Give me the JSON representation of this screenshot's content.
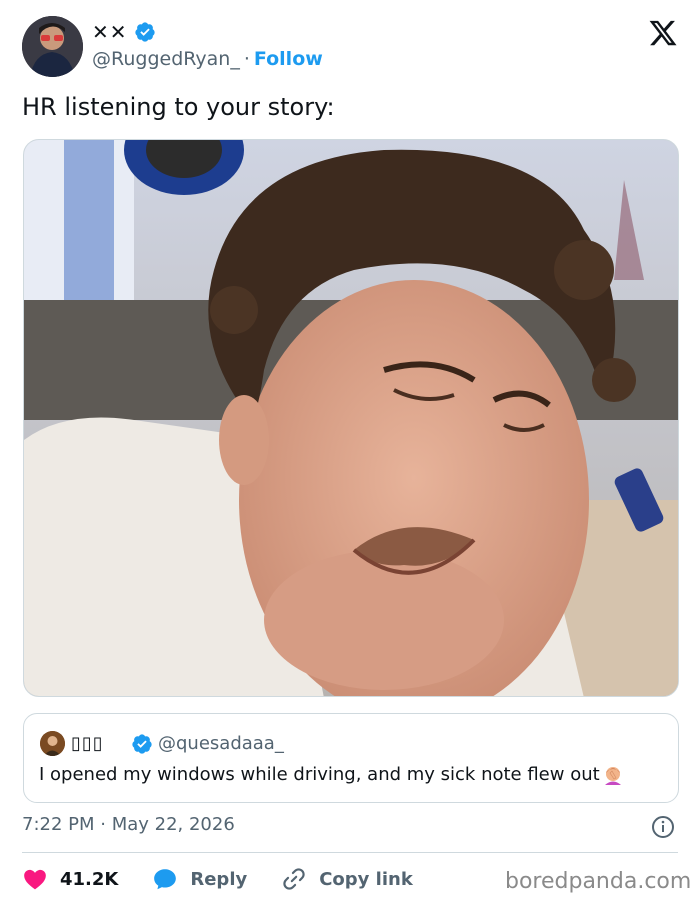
{
  "author": {
    "display_name": "✕✕",
    "handle": "@RuggedRyan_",
    "separator": "·",
    "follow_label": "Follow"
  },
  "tweet": {
    "text": "HR listening to your story:",
    "timestamp": "7:22 PM · May 22, 2026"
  },
  "quote": {
    "display_name": "▯▯▯",
    "handle": "@quesadaaa_",
    "text": "I opened my windows while driving, and my sick note flew out"
  },
  "engagement": {
    "likes": "41.2K",
    "reply_label": "Reply",
    "copy_link_label": "Copy link"
  },
  "watermark": "boredpanda.com",
  "icons": {
    "verified": "verified-badge-icon",
    "x_logo": "x-logo-icon",
    "info": "info-icon",
    "heart": "heart-icon",
    "reply": "reply-bubble-icon",
    "link": "link-icon"
  },
  "colors": {
    "accent": "#1d9bf0",
    "like": "#f91880",
    "secondary_text": "#536471",
    "border": "#cfd9de"
  }
}
